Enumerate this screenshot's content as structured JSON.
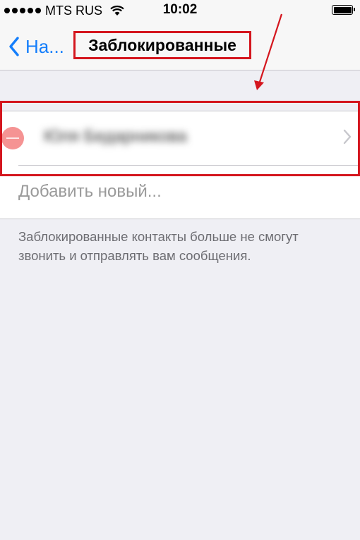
{
  "status_bar": {
    "carrier": "MTS RUS",
    "time": "10:02"
  },
  "nav": {
    "back_label": "На...",
    "title": "Заблокированные"
  },
  "blocked": {
    "contacts": [
      {
        "name": "Юля Бедарникова"
      }
    ],
    "add_new_label": "Добавить новый..."
  },
  "footer": {
    "note": "Заблокированные контакты больше не смогут звонить и отправлять вам сообщения."
  },
  "colors": {
    "accent": "#147efb",
    "annotation": "#d4161e",
    "delete": "#f59393",
    "background": "#efeff4"
  },
  "icons": [
    "wifi-icon",
    "battery-icon",
    "chevron-left-icon",
    "delete-icon",
    "chevron-right-icon"
  ]
}
